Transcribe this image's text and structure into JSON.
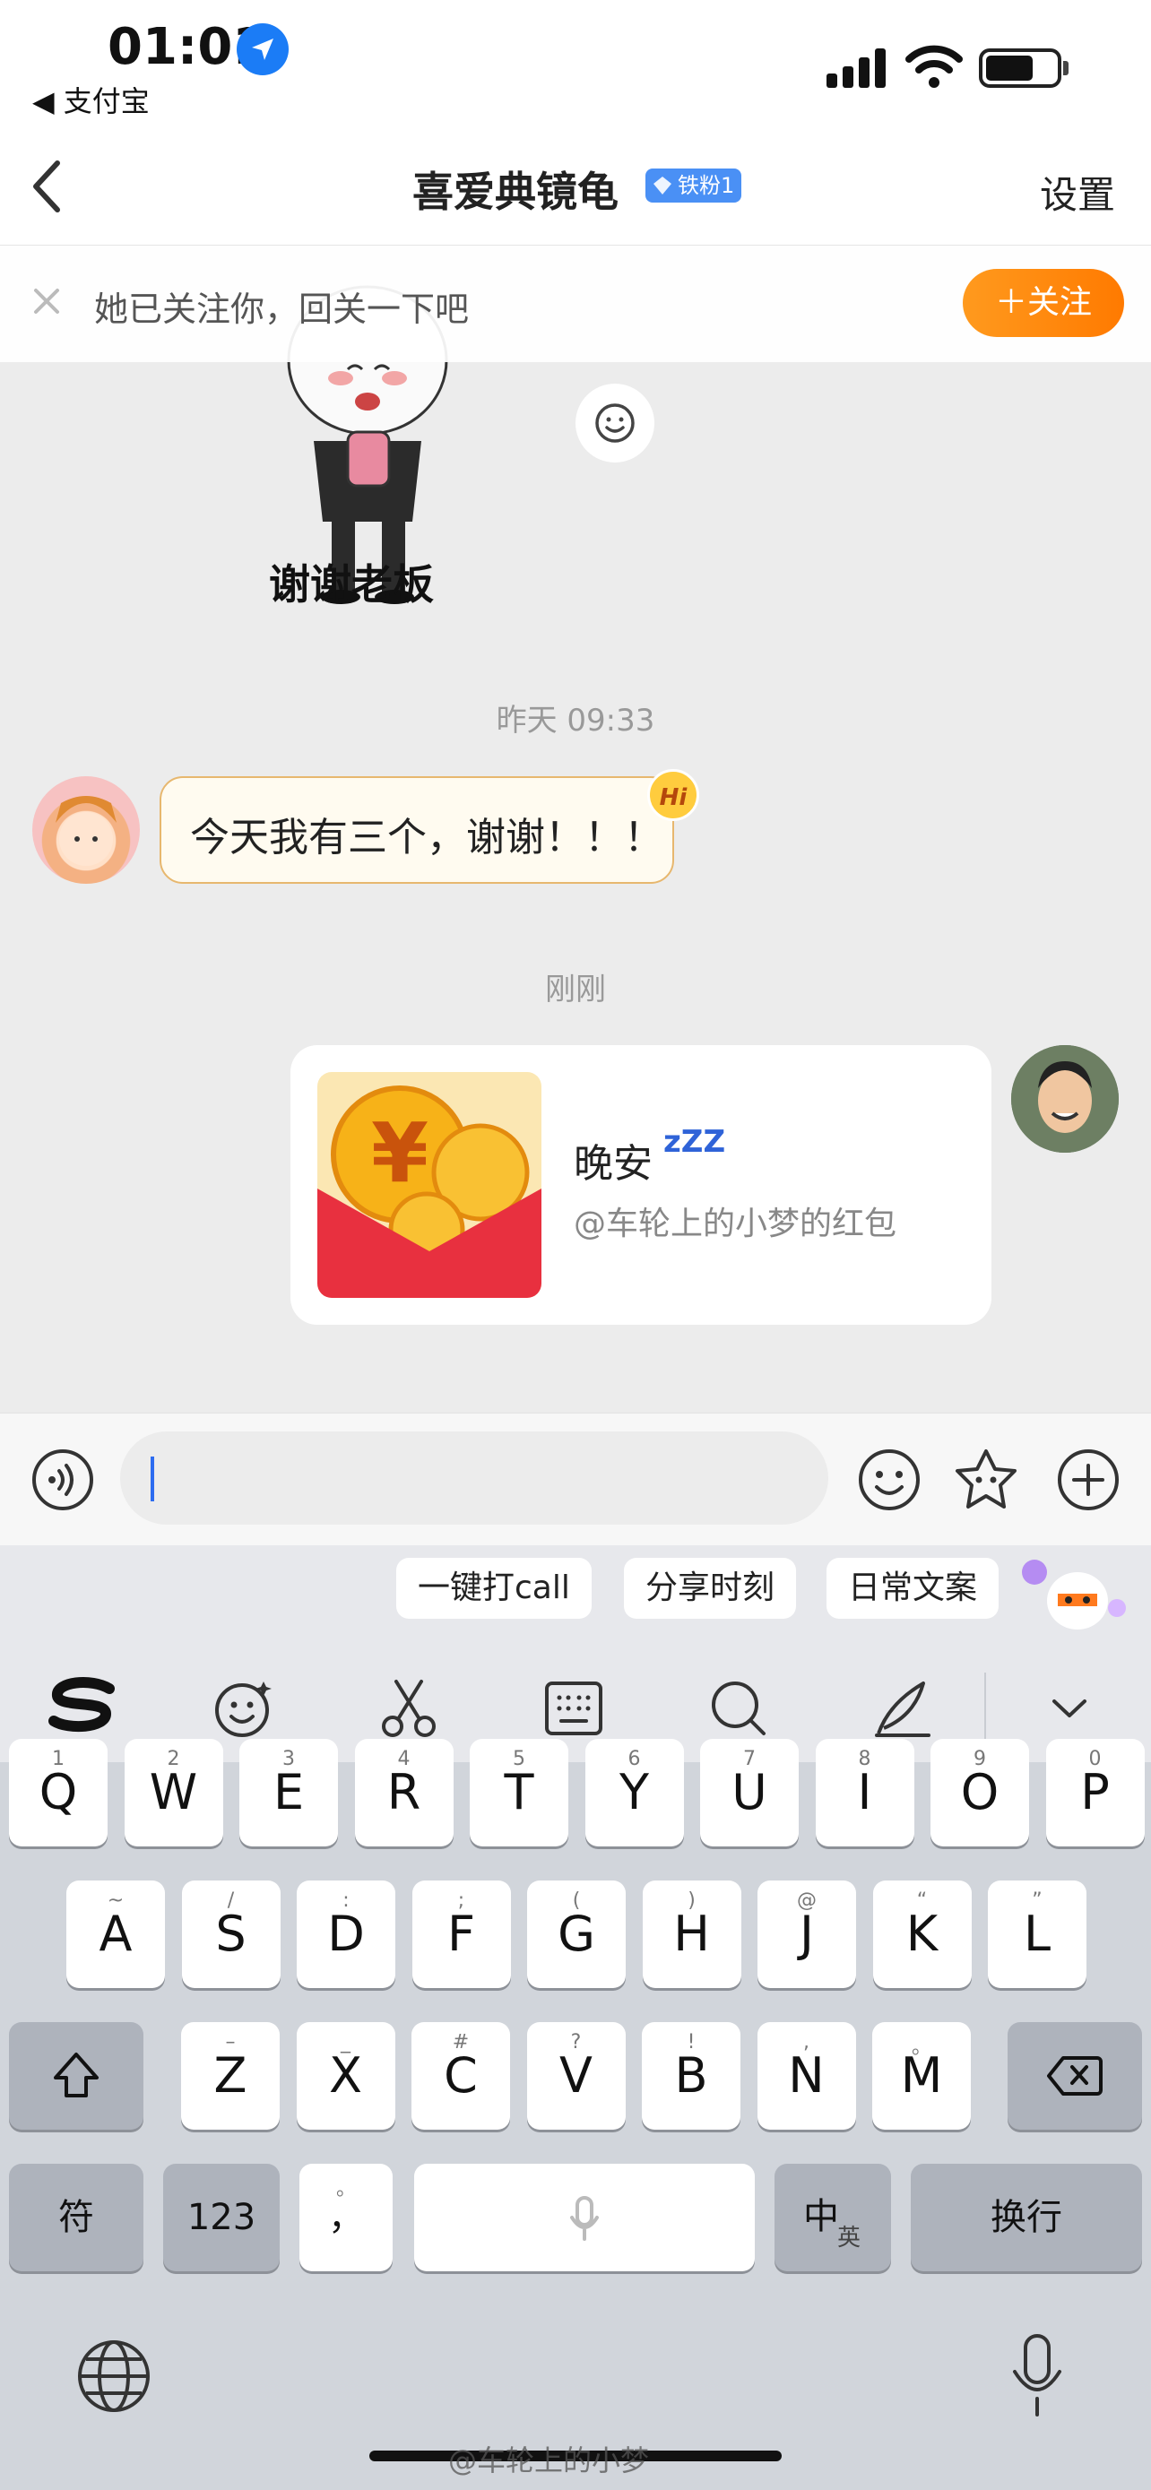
{
  "status_bar": {
    "time": "01:01",
    "back_app": "◀ 支付宝"
  },
  "nav": {
    "title": "喜爱典镜龟",
    "fan_badge": "铁粉1",
    "settings": "设置"
  },
  "follow_banner": {
    "text": "她已关注你，回关一下吧",
    "button": "＋关注"
  },
  "sticker": {
    "caption": "谢谢老板"
  },
  "messages": {
    "time_1": "昨天 09:33",
    "incoming_text": "今天我有三个，谢谢！！！",
    "hi_badge": "Hi",
    "time_2": "刚刚",
    "red_packet": {
      "title": "晚安",
      "zzz": "zZZ",
      "subtitle": "@车轮上的小梦的红包"
    }
  },
  "input": {
    "placeholder": ""
  },
  "keyboard": {
    "suggestions": [
      "一键打call",
      "分享时刻",
      "日常文案"
    ],
    "row1": [
      {
        "k": "Q",
        "h": "1"
      },
      {
        "k": "W",
        "h": "2"
      },
      {
        "k": "E",
        "h": "3"
      },
      {
        "k": "R",
        "h": "4"
      },
      {
        "k": "T",
        "h": "5"
      },
      {
        "k": "Y",
        "h": "6"
      },
      {
        "k": "U",
        "h": "7"
      },
      {
        "k": "I",
        "h": "8"
      },
      {
        "k": "O",
        "h": "9"
      },
      {
        "k": "P",
        "h": "0"
      }
    ],
    "row2": [
      {
        "k": "A",
        "h": "~"
      },
      {
        "k": "S",
        "h": "/"
      },
      {
        "k": "D",
        "h": ":"
      },
      {
        "k": "F",
        "h": ";"
      },
      {
        "k": "G",
        "h": "("
      },
      {
        "k": "H",
        "h": ")"
      },
      {
        "k": "J",
        "h": "@"
      },
      {
        "k": "K",
        "h": "“"
      },
      {
        "k": "L",
        "h": "”"
      }
    ],
    "row3": [
      {
        "k": "Z",
        "h": "–"
      },
      {
        "k": "X",
        "h": "_"
      },
      {
        "k": "C",
        "h": "#"
      },
      {
        "k": "V",
        "h": "?"
      },
      {
        "k": "B",
        "h": "!"
      },
      {
        "k": "N",
        "h": ","
      },
      {
        "k": "M",
        "h": "。"
      }
    ],
    "fu_key": "符",
    "num_key": "123",
    "punct_key": "，",
    "punct_hint": "。",
    "lang_key_main": "中",
    "lang_key_sub": "英",
    "enter_key": "换行"
  },
  "watermark": "@车轮上的小梦",
  "icons": {
    "location": "location-arrow-icon",
    "signal": "cellular-signal-icon",
    "wifi": "wifi-icon",
    "battery": "battery-icon",
    "back": "chevron-left-icon",
    "close": "close-icon",
    "reaction": "emoji-reaction-icon",
    "voice": "voice-icon",
    "emoji": "emoji-icon",
    "sticker": "sticker-icon",
    "plus": "plus-circle-icon"
  },
  "colors": {
    "accent_orange": "#ff8a00",
    "badge_blue": "#4a90f5",
    "caret_blue": "#2d6cf0",
    "red_packet": "#e8303f"
  }
}
